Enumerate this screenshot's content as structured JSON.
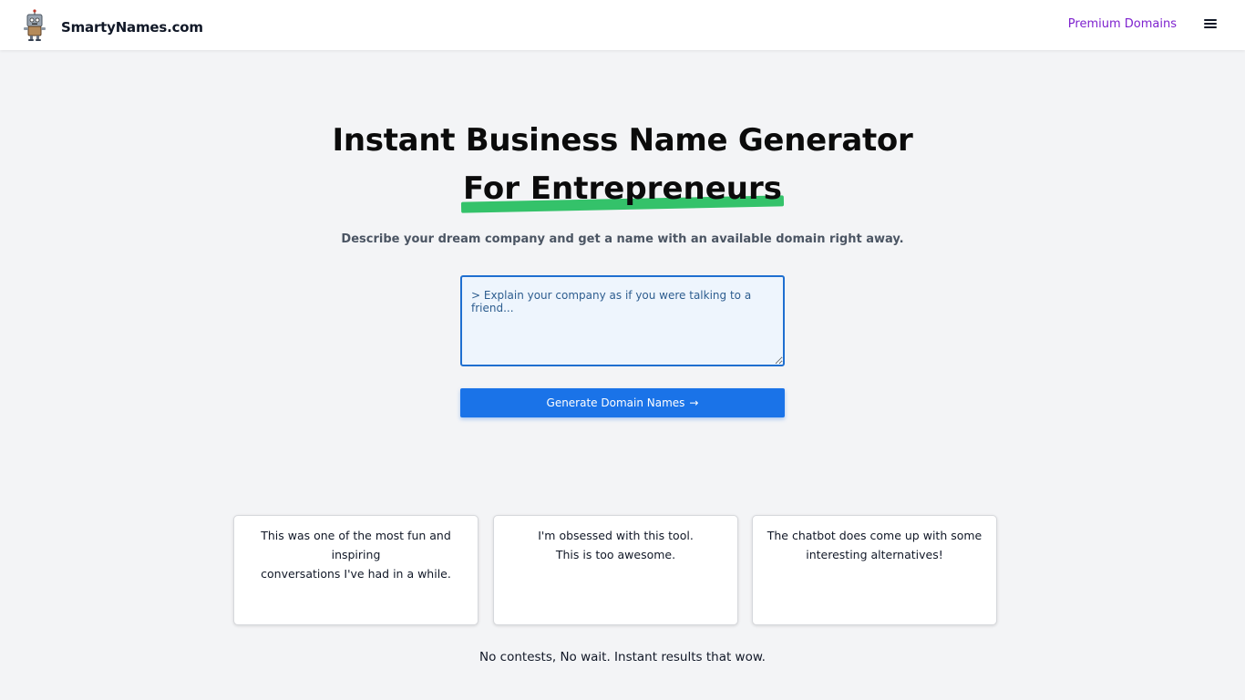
{
  "header": {
    "brand": "SmartyNames.com",
    "logo_icon": "robot-mascot-icon",
    "premium_link": "Premium Domains",
    "menu_icon": "hamburger-menu-icon",
    "accent_color": "#7e22ce"
  },
  "hero": {
    "title": "Instant Business Name Generator",
    "subtitle_highlight": "For Entrepreneurs",
    "highlight_color": "#34c26a",
    "tagline": "Describe your dream company and get a name with an available domain right away."
  },
  "prompt": {
    "placeholder": "> Explain your company as if you were talking to a friend...",
    "value": ""
  },
  "generate_button": {
    "label": "Generate Domain Names",
    "arrow": "→",
    "color": "#1a73e8"
  },
  "testimonials": [
    {
      "line1": "This was one of the most fun and inspiring",
      "line2": "conversations I've had in a while."
    },
    {
      "line1": "I'm obsessed with this tool.",
      "line2": "This is too awesome."
    },
    {
      "line1": "The chatbot does come up with some",
      "line2": "interesting alternatives!"
    }
  ],
  "footer_note": "No contests, No wait. Instant results that wow."
}
